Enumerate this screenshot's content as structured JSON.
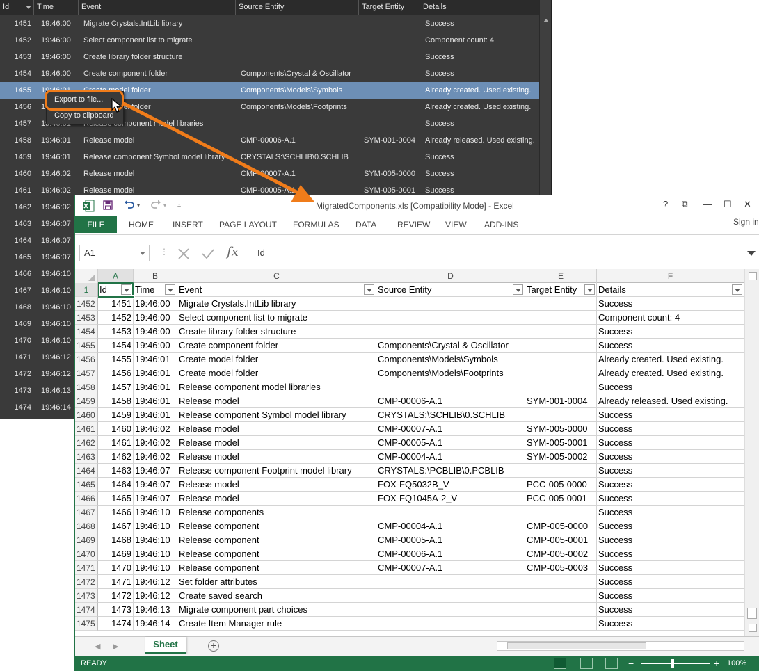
{
  "log_panel": {
    "columns": [
      "Id",
      "Time",
      "Event",
      "Source Entity",
      "Target Entity",
      "Details"
    ],
    "rows": [
      {
        "id": "1451",
        "time": "19:46:00",
        "event": "Migrate Crystals.IntLib library",
        "source": "",
        "target": "",
        "details": "Success"
      },
      {
        "id": "1452",
        "time": "19:46:00",
        "event": "Select component list to migrate",
        "source": "",
        "target": "",
        "details": "Component count: 4"
      },
      {
        "id": "1453",
        "time": "19:46:00",
        "event": "Create library folder structure",
        "source": "",
        "target": "",
        "details": "Success"
      },
      {
        "id": "1454",
        "time": "19:46:00",
        "event": "Create component folder",
        "source": "Components\\Crystal & Oscillator",
        "target": "",
        "details": "Success"
      },
      {
        "id": "1455",
        "time": "19:46:01",
        "event": "Create model folder",
        "source": "Components\\Models\\Symbols",
        "target": "",
        "details": "Already created. Used existing."
      },
      {
        "id": "1456",
        "time": "19:46:01",
        "event": "Create model folder",
        "source": "Components\\Models\\Footprints",
        "target": "",
        "details": "Already created. Used existing."
      },
      {
        "id": "1457",
        "time": "19:46:01",
        "event": "Release component model libraries",
        "source": "",
        "target": "",
        "details": "Success"
      },
      {
        "id": "1458",
        "time": "19:46:01",
        "event": "Release model",
        "source": "CMP-00006-A.1",
        "target": "SYM-001-0004",
        "details": "Already released. Used existing."
      },
      {
        "id": "1459",
        "time": "19:46:01",
        "event": "Release component Symbol model library",
        "source": "CRYSTALS:\\SCHLIB\\0.SCHLIB",
        "target": "",
        "details": "Success"
      },
      {
        "id": "1460",
        "time": "19:46:02",
        "event": "Release model",
        "source": "CMP-00007-A.1",
        "target": "SYM-005-0000",
        "details": "Success"
      },
      {
        "id": "1461",
        "time": "19:46:02",
        "event": "Release model",
        "source": "CMP-00005-A.1",
        "target": "SYM-005-0001",
        "details": "Success"
      },
      {
        "id": "1462",
        "time": "19:46:02",
        "event": "",
        "source": "",
        "target": "",
        "details": ""
      },
      {
        "id": "1463",
        "time": "19:46:07",
        "event": "",
        "source": "",
        "target": "",
        "details": ""
      },
      {
        "id": "1464",
        "time": "19:46:07",
        "event": "",
        "source": "",
        "target": "",
        "details": ""
      },
      {
        "id": "1465",
        "time": "19:46:07",
        "event": "",
        "source": "",
        "target": "",
        "details": ""
      },
      {
        "id": "1466",
        "time": "19:46:10",
        "event": "",
        "source": "",
        "target": "",
        "details": ""
      },
      {
        "id": "1467",
        "time": "19:46:10",
        "event": "",
        "source": "",
        "target": "",
        "details": ""
      },
      {
        "id": "1468",
        "time": "19:46:10",
        "event": "",
        "source": "",
        "target": "",
        "details": ""
      },
      {
        "id": "1469",
        "time": "19:46:10",
        "event": "",
        "source": "",
        "target": "",
        "details": ""
      },
      {
        "id": "1470",
        "time": "19:46:10",
        "event": "",
        "source": "",
        "target": "",
        "details": ""
      },
      {
        "id": "1471",
        "time": "19:46:12",
        "event": "",
        "source": "",
        "target": "",
        "details": ""
      },
      {
        "id": "1472",
        "time": "19:46:12",
        "event": "",
        "source": "",
        "target": "",
        "details": ""
      },
      {
        "id": "1473",
        "time": "19:46:13",
        "event": "",
        "source": "",
        "target": "",
        "details": ""
      },
      {
        "id": "1474",
        "time": "19:46:14",
        "event": "",
        "source": "",
        "target": "",
        "details": ""
      }
    ],
    "context_menu": {
      "export": "Export to file...",
      "copy": "Copy to clipboard"
    }
  },
  "excel": {
    "title": "MigratedComponents.xls  [Compatibility Mode] - Excel",
    "window_controls": {
      "help": "?",
      "restore_ribbon": "⧉",
      "minimize": "—",
      "maximize": "☐",
      "close": "✕"
    },
    "ribbon_tabs": [
      "FILE",
      "HOME",
      "INSERT",
      "PAGE LAYOUT",
      "FORMULAS",
      "DATA",
      "REVIEW",
      "VIEW",
      "ADD-INS"
    ],
    "sign_in": "Sign in",
    "name_box": "A1",
    "formula": "Id",
    "fx": "fx",
    "col_letters": [
      "A",
      "B",
      "C",
      "D",
      "E",
      "F"
    ],
    "header_row_num": "1",
    "headers": [
      "Id",
      "Time",
      "Event",
      "Source Entity",
      "Target Entity",
      "Details"
    ],
    "rows": [
      {
        "rn": "1452",
        "id": "1451",
        "time": "19:46:00",
        "event": "Migrate Crystals.IntLib library",
        "source": "",
        "target": "",
        "details": "Success"
      },
      {
        "rn": "1453",
        "id": "1452",
        "time": "19:46:00",
        "event": "Select component list to migrate",
        "source": "",
        "target": "",
        "details": "Component count: 4"
      },
      {
        "rn": "1454",
        "id": "1453",
        "time": "19:46:00",
        "event": "Create library folder structure",
        "source": "",
        "target": "",
        "details": "Success"
      },
      {
        "rn": "1455",
        "id": "1454",
        "time": "19:46:00",
        "event": "Create component folder",
        "source": "Components\\Crystal & Oscillator",
        "target": "",
        "details": "Success"
      },
      {
        "rn": "1456",
        "id": "1455",
        "time": "19:46:01",
        "event": "Create model folder",
        "source": "Components\\Models\\Symbols",
        "target": "",
        "details": "Already created. Used existing."
      },
      {
        "rn": "1457",
        "id": "1456",
        "time": "19:46:01",
        "event": "Create model folder",
        "source": "Components\\Models\\Footprints",
        "target": "",
        "details": "Already created. Used existing."
      },
      {
        "rn": "1458",
        "id": "1457",
        "time": "19:46:01",
        "event": "Release component model libraries",
        "source": "",
        "target": "",
        "details": "Success"
      },
      {
        "rn": "1459",
        "id": "1458",
        "time": "19:46:01",
        "event": "Release model",
        "source": "CMP-00006-A.1",
        "target": "SYM-001-0004",
        "details": "Already released. Used existing."
      },
      {
        "rn": "1460",
        "id": "1459",
        "time": "19:46:01",
        "event": "Release component Symbol model library",
        "source": "CRYSTALS:\\SCHLIB\\0.SCHLIB",
        "target": "",
        "details": "Success"
      },
      {
        "rn": "1461",
        "id": "1460",
        "time": "19:46:02",
        "event": "Release model",
        "source": "CMP-00007-A.1",
        "target": "SYM-005-0000",
        "details": "Success"
      },
      {
        "rn": "1462",
        "id": "1461",
        "time": "19:46:02",
        "event": "Release model",
        "source": "CMP-00005-A.1",
        "target": "SYM-005-0001",
        "details": "Success"
      },
      {
        "rn": "1463",
        "id": "1462",
        "time": "19:46:02",
        "event": "Release model",
        "source": "CMP-00004-A.1",
        "target": "SYM-005-0002",
        "details": "Success"
      },
      {
        "rn": "1464",
        "id": "1463",
        "time": "19:46:07",
        "event": "Release component Footprint model library",
        "source": "CRYSTALS:\\PCBLIB\\0.PCBLIB",
        "target": "",
        "details": "Success"
      },
      {
        "rn": "1465",
        "id": "1464",
        "time": "19:46:07",
        "event": "Release model",
        "source": "FOX-FQ5032B_V",
        "target": "PCC-005-0000",
        "details": "Success"
      },
      {
        "rn": "1466",
        "id": "1465",
        "time": "19:46:07",
        "event": "Release model",
        "source": "FOX-FQ1045A-2_V",
        "target": "PCC-005-0001",
        "details": "Success"
      },
      {
        "rn": "1467",
        "id": "1466",
        "time": "19:46:10",
        "event": "Release components",
        "source": "",
        "target": "",
        "details": "Success"
      },
      {
        "rn": "1468",
        "id": "1467",
        "time": "19:46:10",
        "event": "Release component",
        "source": "CMP-00004-A.1",
        "target": "CMP-005-0000",
        "details": "Success"
      },
      {
        "rn": "1469",
        "id": "1468",
        "time": "19:46:10",
        "event": "Release component",
        "source": "CMP-00005-A.1",
        "target": "CMP-005-0001",
        "details": "Success"
      },
      {
        "rn": "1470",
        "id": "1469",
        "time": "19:46:10",
        "event": "Release component",
        "source": "CMP-00006-A.1",
        "target": "CMP-005-0002",
        "details": "Success"
      },
      {
        "rn": "1471",
        "id": "1470",
        "time": "19:46:10",
        "event": "Release component",
        "source": "CMP-00007-A.1",
        "target": "CMP-005-0003",
        "details": "Success"
      },
      {
        "rn": "1472",
        "id": "1471",
        "time": "19:46:12",
        "event": "Set folder attributes",
        "source": "",
        "target": "",
        "details": "Success"
      },
      {
        "rn": "1473",
        "id": "1472",
        "time": "19:46:12",
        "event": "Create saved search",
        "source": "",
        "target": "",
        "details": "Success"
      },
      {
        "rn": "1474",
        "id": "1473",
        "time": "19:46:13",
        "event": "Migrate component part choices",
        "source": "",
        "target": "",
        "details": "Success"
      },
      {
        "rn": "1475",
        "id": "1474",
        "time": "19:46:14",
        "event": "Create Item Manager rule",
        "source": "",
        "target": "",
        "details": "Success"
      }
    ],
    "sheet_tab": "Sheet",
    "add_sheet": "+",
    "status": "READY",
    "zoom_minus": "−",
    "zoom_plus": "+",
    "zoom": "100%"
  },
  "colors": {
    "excel_green": "#217346",
    "highlight_orange": "#f07c1a",
    "log_bg": "#3a3a3a",
    "log_selected": "#6d8fb6"
  }
}
